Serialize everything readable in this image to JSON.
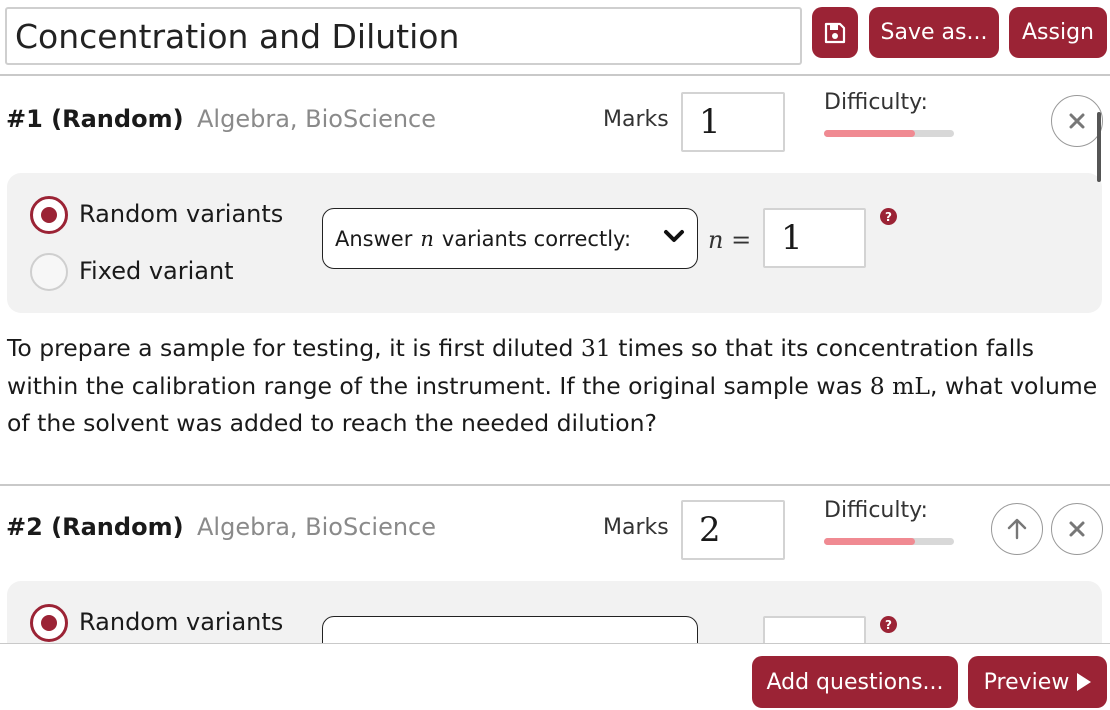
{
  "header": {
    "title_value": "Concentration and Dilution",
    "save_as_label": "Save as...",
    "assign_label": "Assign"
  },
  "questions": [
    {
      "number": "#1 (Random)",
      "topics": "Algebra, BioScience",
      "marks_label": "Marks",
      "marks_value": "1",
      "difficulty_label": "Difficulty:",
      "difficulty_level": 0.7,
      "random_label": "Random variants",
      "fixed_label": "Fixed variant",
      "dropdown_prefix": "Answer",
      "dropdown_var": "n",
      "dropdown_suffix": "variants correctly:",
      "n_label": "n =",
      "n_value": "1",
      "help": "?",
      "text_parts": [
        "To prepare a sample for testing, it is first diluted ",
        "31",
        " times so that its concentration falls within the calibration range of the instrument. If the original sample was ",
        "8 mL",
        ", what volume of the solvent was added to reach the needed dilution?"
      ]
    },
    {
      "number": "#2 (Random)",
      "topics": "Algebra, BioScience",
      "marks_label": "Marks",
      "marks_value": "2",
      "difficulty_label": "Difficulty:",
      "difficulty_level": 0.7,
      "random_label": "Random variants",
      "help": "?"
    }
  ],
  "footer": {
    "add_questions_label": "Add questions...",
    "preview_label": "Preview"
  },
  "colors": {
    "accent": "#9b2335",
    "difficulty_fill": "#f08a92",
    "panel_bg": "#f2f2f2"
  }
}
